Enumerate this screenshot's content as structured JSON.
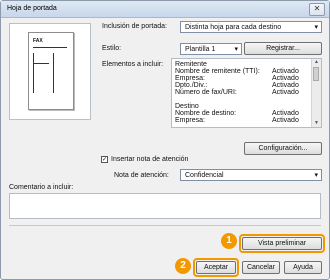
{
  "window": {
    "title": "Hoja de portada",
    "close_glyph": "✕"
  },
  "preview": {
    "fax_label": "FAX"
  },
  "cover": {
    "label": "Inclusión de portada:",
    "value": "Distinta hoja para cada destino"
  },
  "style": {
    "label": "Estilo:",
    "value": "Plantilla 1",
    "register_button": "Registrar..."
  },
  "elements": {
    "label": "Elementos a incluir:",
    "rows": [
      {
        "k": "Remitente",
        "v": ""
      },
      {
        "k": "Nombre de remitente (TTI):",
        "v": "Activado"
      },
      {
        "k": "Empresa:",
        "v": "Activado"
      },
      {
        "k": "Dpto./Div.:",
        "v": "Activado"
      },
      {
        "k": "Número de fax/URI:",
        "v": "Activado"
      },
      {
        "k": "",
        "v": ""
      },
      {
        "k": "Destino",
        "v": ""
      },
      {
        "k": "Nombre de destino:",
        "v": "Activado"
      },
      {
        "k": "Empresa:",
        "v": "Activado"
      }
    ]
  },
  "config_button": "Configuración...",
  "attention": {
    "checkbox_label": "Insertar nota de atención",
    "checked": true,
    "note_label": "Nota de atención:",
    "note_value": "Confidencial"
  },
  "comment": {
    "label": "Comentario a incluir:",
    "value": ""
  },
  "buttons": {
    "preview": "Vista preliminar",
    "accept": "Aceptar",
    "cancel": "Cancelar",
    "help": "Ayuda"
  },
  "callouts": {
    "one": "1",
    "two": "2"
  },
  "colors": {
    "callout": "#f39800",
    "titlebar": "#c7d6ea"
  }
}
